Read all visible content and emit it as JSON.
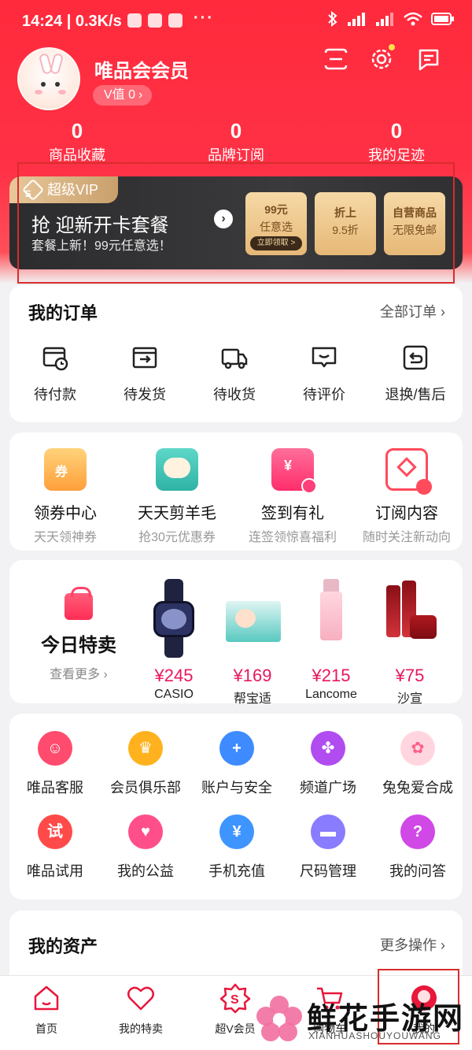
{
  "status_bar": {
    "time": "14:24",
    "network_speed": "0.3K/s",
    "more": "···"
  },
  "profile": {
    "name": "唯品会会员",
    "v_value": "V值 0"
  },
  "stats": [
    {
      "num": "0",
      "label": "商品收藏"
    },
    {
      "num": "0",
      "label": "品牌订阅"
    },
    {
      "num": "0",
      "label": "我的足迹"
    }
  ],
  "vip_banner": {
    "tag": "超级VIP",
    "title": "抢 迎新开卡套餐",
    "subtitle": "套餐上新！99元任意选！",
    "cards": [
      {
        "line1": "99元",
        "line2": "任意选",
        "button": "立即领取 >"
      },
      {
        "line1": "折上",
        "line2": "9.5折"
      },
      {
        "line1": "自营商品",
        "line2": "无限免邮"
      }
    ]
  },
  "orders": {
    "title": "我的订单",
    "more": "全部订单",
    "items": [
      {
        "label": "待付款",
        "icon": "wallet-clock-icon"
      },
      {
        "label": "待发货",
        "icon": "box-arrow-icon"
      },
      {
        "label": "待收货",
        "icon": "truck-icon"
      },
      {
        "label": "待评价",
        "icon": "chat-check-icon"
      },
      {
        "label": "退换/售后",
        "icon": "return-icon"
      }
    ]
  },
  "tools": [
    {
      "title": "领券中心",
      "sub": "天天领神券",
      "icon": "coupon-icon"
    },
    {
      "title": "天天剪羊毛",
      "sub": "抢30元优惠券",
      "icon": "sheep-icon"
    },
    {
      "title": "签到有礼",
      "sub": "连签领惊喜福利",
      "icon": "checkin-icon"
    },
    {
      "title": "订阅内容",
      "sub": "随时关注新动向",
      "icon": "subscribe-icon"
    }
  ],
  "deals": {
    "title": "今日特卖",
    "more": "查看更多",
    "products": [
      {
        "price": "¥245",
        "brand": "CASIO"
      },
      {
        "price": "¥169",
        "brand": "帮宝适"
      },
      {
        "price": "¥215",
        "brand": "Lancome"
      },
      {
        "price": "¥75",
        "brand": "沙宣"
      }
    ]
  },
  "services": [
    {
      "label": "唯品客服",
      "icon": "headset-icon",
      "color": "#ff4b6e"
    },
    {
      "label": "会员俱乐部",
      "icon": "crown-icon",
      "color": "#ffb21e"
    },
    {
      "label": "账户与安全",
      "icon": "shield-plus-icon",
      "color": "#3d8bff"
    },
    {
      "label": "频道广场",
      "icon": "clover-icon",
      "color": "#b04cf0"
    },
    {
      "label": "兔兔爱合成",
      "icon": "bunny-icon",
      "color": "#ff7fa0"
    },
    {
      "label": "唯品试用",
      "icon": "trial-icon",
      "color": "#ff4a4a",
      "glyph": "试"
    },
    {
      "label": "我的公益",
      "icon": "heart-hands-icon",
      "color": "#ff4f8a"
    },
    {
      "label": "手机充值",
      "icon": "phone-yuan-icon",
      "color": "#3f95ff"
    },
    {
      "label": "尺码管理",
      "icon": "ruler-icon",
      "color": "#8a7cff"
    },
    {
      "label": "我的问答",
      "icon": "question-icon",
      "color": "#d048e6",
      "glyph": "?"
    }
  ],
  "assets": {
    "title": "我的资产",
    "more": "更多操作"
  },
  "tabbar": [
    {
      "label": "首页",
      "icon": "home-icon"
    },
    {
      "label": "我的特卖",
      "icon": "heart-icon"
    },
    {
      "label": "超V会员",
      "icon": "vip-badge-icon"
    },
    {
      "label": "购物车",
      "icon": "cart-icon"
    },
    {
      "label": "我的",
      "icon": "profile-icon"
    }
  ],
  "watermark": {
    "text": "鲜花手游网",
    "sub": "XIANHUASHOUYOUWANG"
  },
  "colors": {
    "brand_red": "#ff2a3c",
    "price_pink": "#e8175d",
    "vip_gold": "#e6b877",
    "highlight": "#d92c2c"
  }
}
